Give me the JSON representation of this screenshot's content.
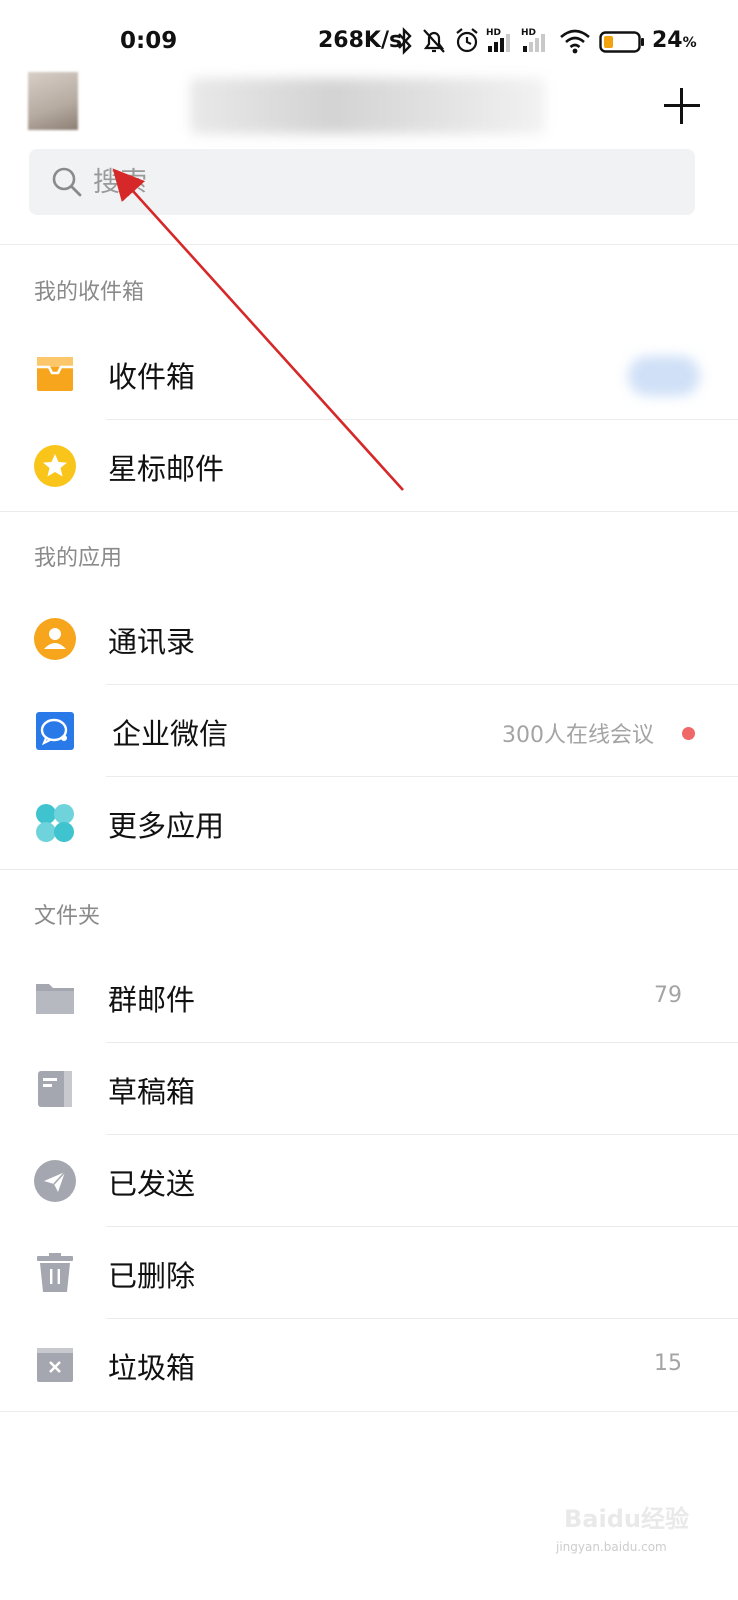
{
  "status_bar": {
    "time": "0:09",
    "speed": "268K/s",
    "signal_1_label": "HD",
    "signal_2_label": "HD",
    "battery_percent": "24",
    "battery_unit": "%"
  },
  "header": {
    "add_icon": "plus-icon"
  },
  "search": {
    "placeholder": "搜索"
  },
  "sections": {
    "inbox_title": "我的收件箱",
    "apps_title": "我的应用",
    "folders_title": "文件夹"
  },
  "inbox_items": [
    {
      "label": "收件箱",
      "icon": "inbox-icon"
    },
    {
      "label": "星标邮件",
      "icon": "star-icon"
    }
  ],
  "app_items": [
    {
      "label": "通讯录",
      "icon": "contacts-icon"
    },
    {
      "label": "企业微信",
      "icon": "wecom-icon",
      "right_text": "300人在线会议"
    },
    {
      "label": "更多应用",
      "icon": "apps-icon"
    }
  ],
  "folder_items": [
    {
      "label": "群邮件",
      "icon": "folder-icon",
      "count": "79"
    },
    {
      "label": "草稿箱",
      "icon": "drafts-icon"
    },
    {
      "label": "已发送",
      "icon": "sent-icon"
    },
    {
      "label": "已删除",
      "icon": "trash-icon"
    },
    {
      "label": "垃圾箱",
      "icon": "spam-icon",
      "count": "15"
    }
  ],
  "watermark": {
    "brand": "Baidu经验",
    "url": "jingyan.baidu.com"
  },
  "colors": {
    "accent_orange": "#f7a51c",
    "star_yellow": "#f9c51a",
    "wecom_blue": "#2a79e8",
    "apps_teal": "#3fc3cf",
    "folder_gray": "#a5a7b0",
    "notice_red": "#f06767",
    "annotation_red": "#d62828"
  }
}
